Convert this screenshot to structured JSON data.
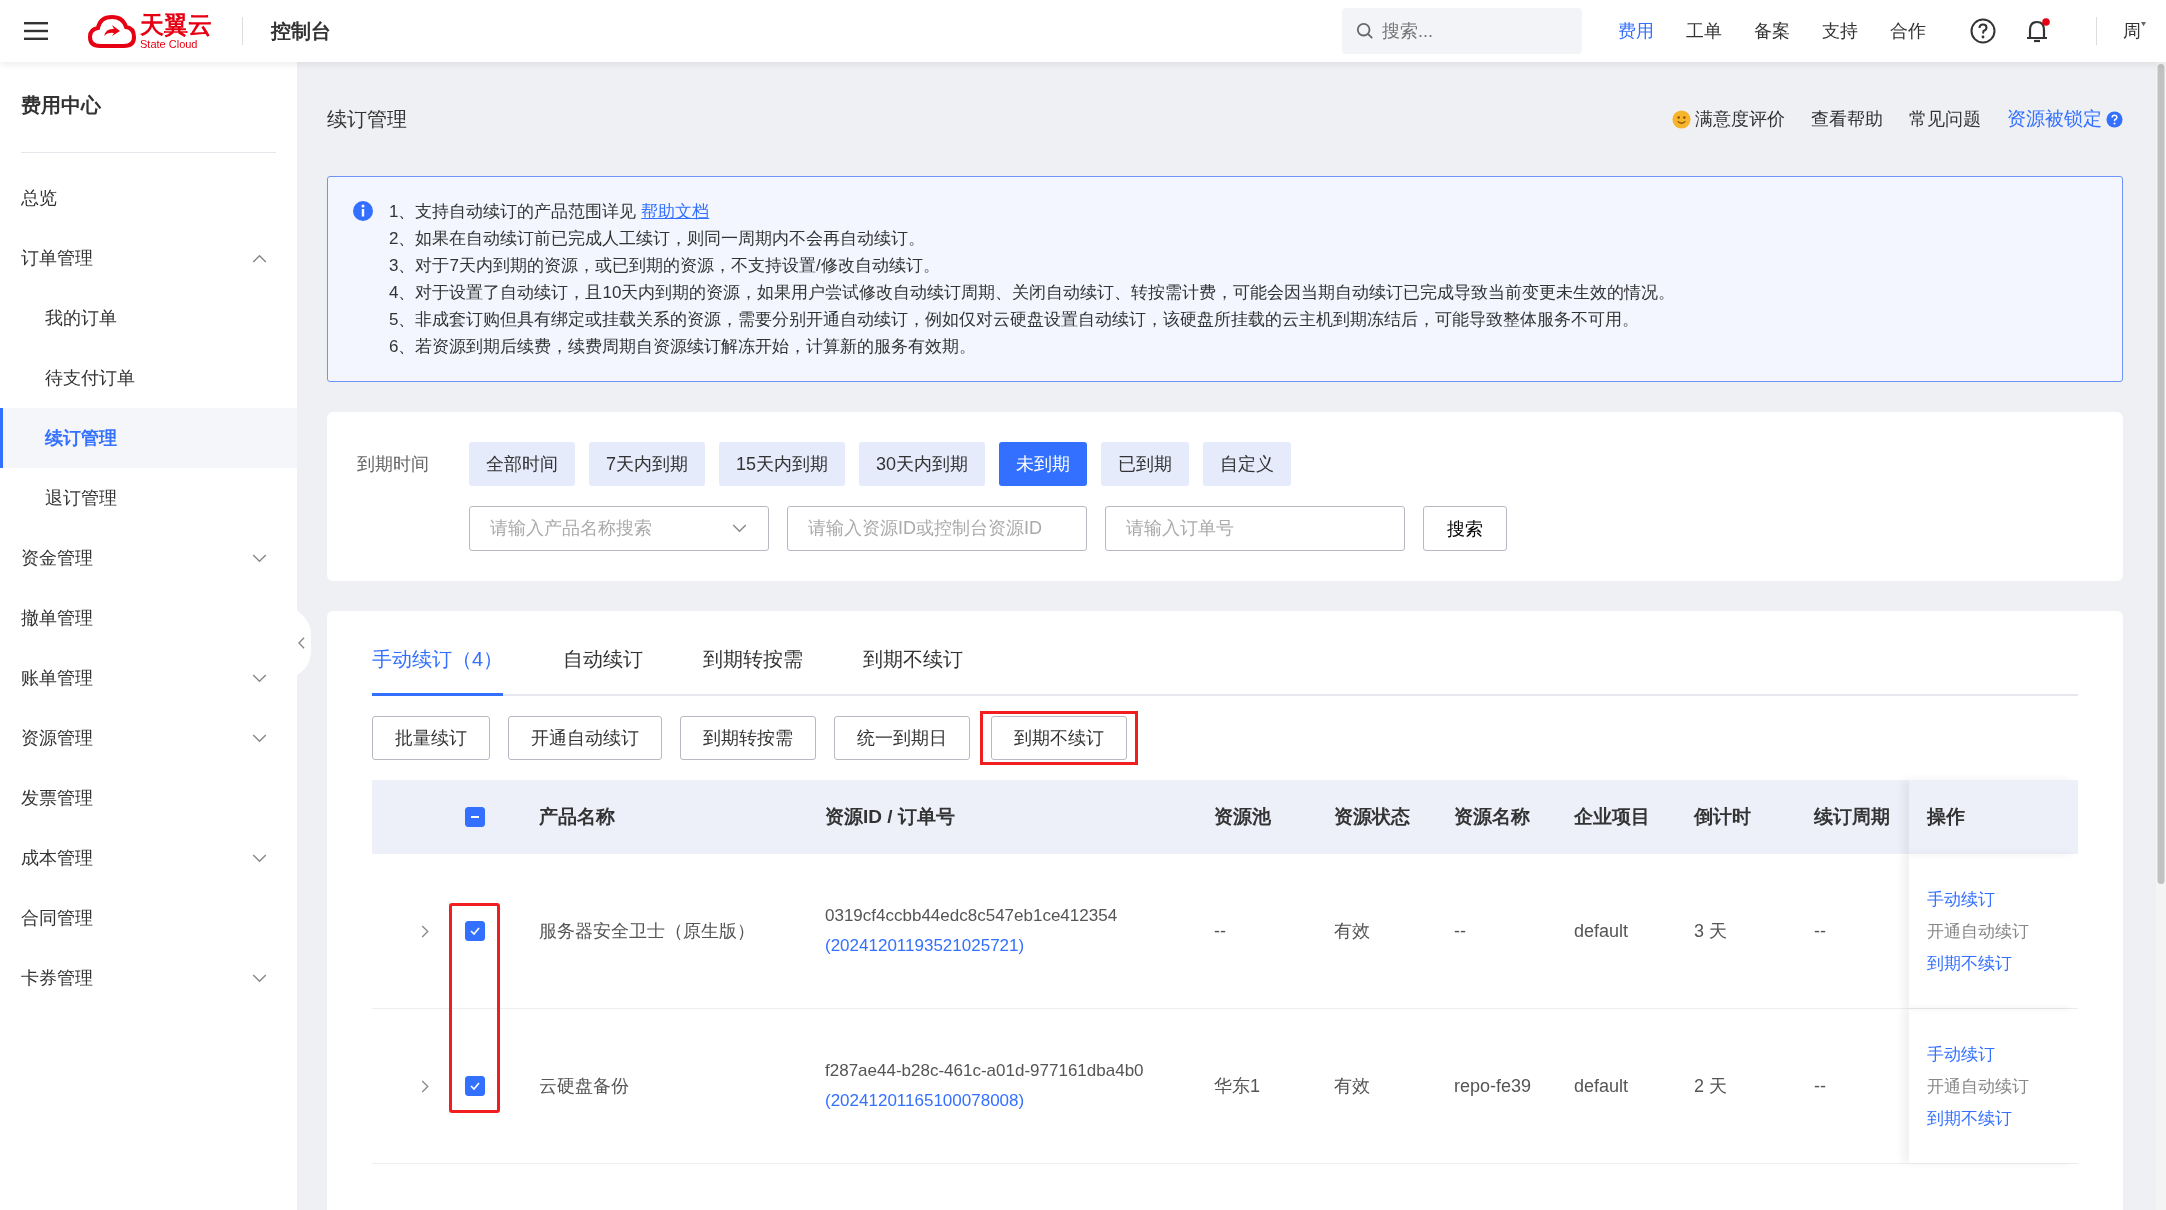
{
  "header": {
    "logo": {
      "name": "天翼云",
      "subtitle": "State Cloud"
    },
    "console_title": "控制台",
    "search": {
      "placeholder": "搜索..."
    },
    "nav": [
      {
        "label": "费用",
        "selected": true
      },
      {
        "label": "工单",
        "selected": false
      },
      {
        "label": "备案",
        "selected": false
      },
      {
        "label": "支持",
        "selected": false
      },
      {
        "label": "合作",
        "selected": false
      }
    ],
    "notifications_unread": true,
    "user": "周"
  },
  "sidebar": {
    "title": "费用中心",
    "items": [
      {
        "label": "总览",
        "selected": false
      },
      {
        "label": "订单管理",
        "selected": false,
        "expanded": true,
        "children": [
          {
            "label": "我的订单",
            "selected": false
          },
          {
            "label": "待支付订单",
            "selected": false
          },
          {
            "label": "续订管理",
            "selected": true
          },
          {
            "label": "退订管理",
            "selected": false
          }
        ]
      },
      {
        "label": "资金管理",
        "selected": false,
        "expanded": false
      },
      {
        "label": "撤单管理",
        "selected": false
      },
      {
        "label": "账单管理",
        "selected": false,
        "expanded": false
      },
      {
        "label": "资源管理",
        "selected": false,
        "expanded": false
      },
      {
        "label": "发票管理",
        "selected": false
      },
      {
        "label": "成本管理",
        "selected": false,
        "expanded": false
      },
      {
        "label": "合同管理",
        "selected": false
      },
      {
        "label": "卡券管理",
        "selected": false,
        "expanded": false
      }
    ]
  },
  "page": {
    "title": "续订管理",
    "links": [
      {
        "label": "满意度评价",
        "kind": "rating"
      },
      {
        "label": "查看帮助",
        "kind": "plain"
      },
      {
        "label": "常见问题",
        "kind": "plain"
      },
      {
        "label": "资源被锁定",
        "kind": "help"
      }
    ]
  },
  "notice": {
    "lines": [
      {
        "text": "1、支持自动续订的产品范围详见",
        "link": "帮助文档"
      },
      {
        "text": "2、如果在自动续订前已完成人工续订，则同一周期内不会再自动续订。"
      },
      {
        "text": "3、对于7天内到期的资源，或已到期的资源，不支持设置/修改自动续订。"
      },
      {
        "text": "4、对于设置了自动续订，且10天内到期的资源，如果用户尝试修改自动续订周期、关闭自动续订、转按需计费，可能会因当期自动续订已完成导致当前变更未生效的情况。"
      },
      {
        "text": "5、非成套订购但具有绑定或挂载关系的资源，需要分别开通自动续订，例如仅对云硬盘设置自动续订，该硬盘所挂载的云主机到期冻结后，可能导致整体服务不可用。"
      },
      {
        "text": "6、若资源到期后续费，续费周期自资源续订解冻开始，计算新的服务有效期。"
      }
    ]
  },
  "filters": {
    "label": "到期时间",
    "options": [
      {
        "label": "全部时间",
        "selected": false
      },
      {
        "label": "7天内到期",
        "selected": false
      },
      {
        "label": "15天内到期",
        "selected": false
      },
      {
        "label": "30天内到期",
        "selected": false
      },
      {
        "label": "未到期",
        "selected": true
      },
      {
        "label": "已到期",
        "selected": false
      },
      {
        "label": "自定义",
        "selected": false
      }
    ],
    "product_select": {
      "placeholder": "请输入产品名称搜索"
    },
    "resource_id": {
      "placeholder": "请输入资源ID或控制台资源ID"
    },
    "order_no": {
      "placeholder": "请输入订单号"
    },
    "search_button": "搜索"
  },
  "tabs": [
    {
      "label": "手动续订（4）",
      "selected": true
    },
    {
      "label": "自动续订",
      "selected": false
    },
    {
      "label": "到期转按需",
      "selected": false
    },
    {
      "label": "到期不续订",
      "selected": false
    }
  ],
  "toolbar": [
    {
      "label": "批量续订",
      "highlighted": false
    },
    {
      "label": "开通自动续订",
      "highlighted": false
    },
    {
      "label": "到期转按需",
      "highlighted": false
    },
    {
      "label": "统一到期日",
      "highlighted": false
    },
    {
      "label": "到期不续订",
      "highlighted": true
    }
  ],
  "table": {
    "select_all_indeterminate": true,
    "checkboxes_highlighted": true,
    "columns": [
      "产品名称",
      "资源ID / 订单号",
      "资源池",
      "资源状态",
      "资源名称",
      "企业项目",
      "倒计时",
      "续订周期",
      "操作"
    ],
    "rows": [
      {
        "expanded": false,
        "checked": true,
        "product": "服务器安全卫士（原生版）",
        "resource_id": "0319cf4ccbb44edc8c547eb1ce412354",
        "order_no": "(20241201193521025721)",
        "pool": "--",
        "status": "有效",
        "resource_name": "--",
        "project": "default",
        "countdown": "3 天",
        "period": "--",
        "actions": [
          {
            "label": "手动续订",
            "disabled": false
          },
          {
            "label": "开通自动续订",
            "disabled": true
          },
          {
            "label": "到期不续订",
            "disabled": false
          }
        ]
      },
      {
        "expanded": false,
        "checked": true,
        "product": "云硬盘备份",
        "resource_id": "f287ae44-b28c-461c-a01d-977161dba4b0",
        "order_no": "(20241201165100078008)",
        "pool": "华东1",
        "status": "有效",
        "resource_name": "repo-fe39",
        "project": "default",
        "countdown": "2 天",
        "period": "--",
        "actions": [
          {
            "label": "手动续订",
            "disabled": false
          },
          {
            "label": "开通自动续订",
            "disabled": true
          },
          {
            "label": "到期不续订",
            "disabled": false
          }
        ]
      }
    ]
  }
}
